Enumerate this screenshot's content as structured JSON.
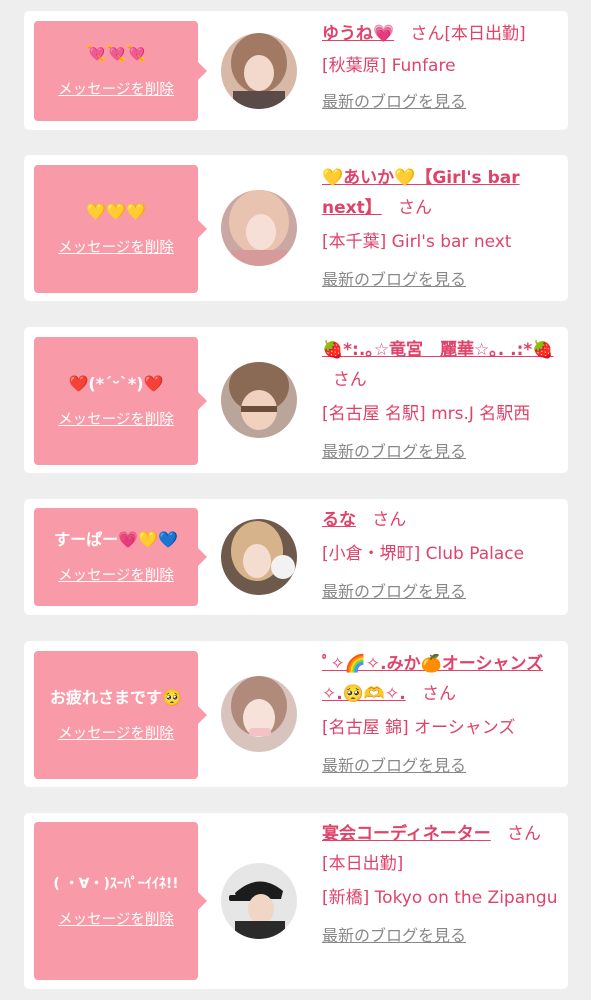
{
  "common": {
    "delete_label": "メッセージを削除",
    "blog_label": "最新のブログを見る",
    "san": "さん"
  },
  "colors": {
    "bubble": "#f99aa8",
    "accent": "#e0436a",
    "link_gray": "#888888",
    "page_bg": "#eeeeee"
  },
  "cards": [
    {
      "message": "💘💘💘",
      "name": "ゆうね💗",
      "suffix": "[本日出勤]",
      "shop": "[秋葉原] Funfare",
      "avatar": "woman-portrait"
    },
    {
      "message": "💛💛💛",
      "name": "💛あいか💛【Girl's bar next】",
      "suffix": "",
      "shop": "[本千葉] Girl's bar next",
      "avatar": "woman-portrait"
    },
    {
      "message": "❤️(*´ᵕ`*)❤️",
      "name": "🍓*:.｡☆竜宮　麗華☆｡. .:*🍓",
      "suffix": "",
      "shop": "[名古屋 名駅] mrs.J 名駅西",
      "avatar": "woman-portrait"
    },
    {
      "message": "すーぱー💗💛💙",
      "name": "るな",
      "suffix": "",
      "shop": "[小倉・堺町] Club Palace",
      "avatar": "woman-portrait"
    },
    {
      "message": "お疲れさまです🥺",
      "name": "ﾟ✧🌈✧.みか🍊オーシャンズ✧.🥺🫶✧.",
      "suffix": "",
      "shop": "[名古屋 錦] オーシャンズ",
      "avatar": "woman-portrait"
    },
    {
      "message": "( ・∀・)ｽｰﾊﾟｰｲｲﾈ!!",
      "name": "宴会コーディネーター",
      "suffix": "[本日出勤]",
      "shop": "[新橋] Tokyo on the Zipangu",
      "avatar": "woman-cap-portrait"
    }
  ]
}
